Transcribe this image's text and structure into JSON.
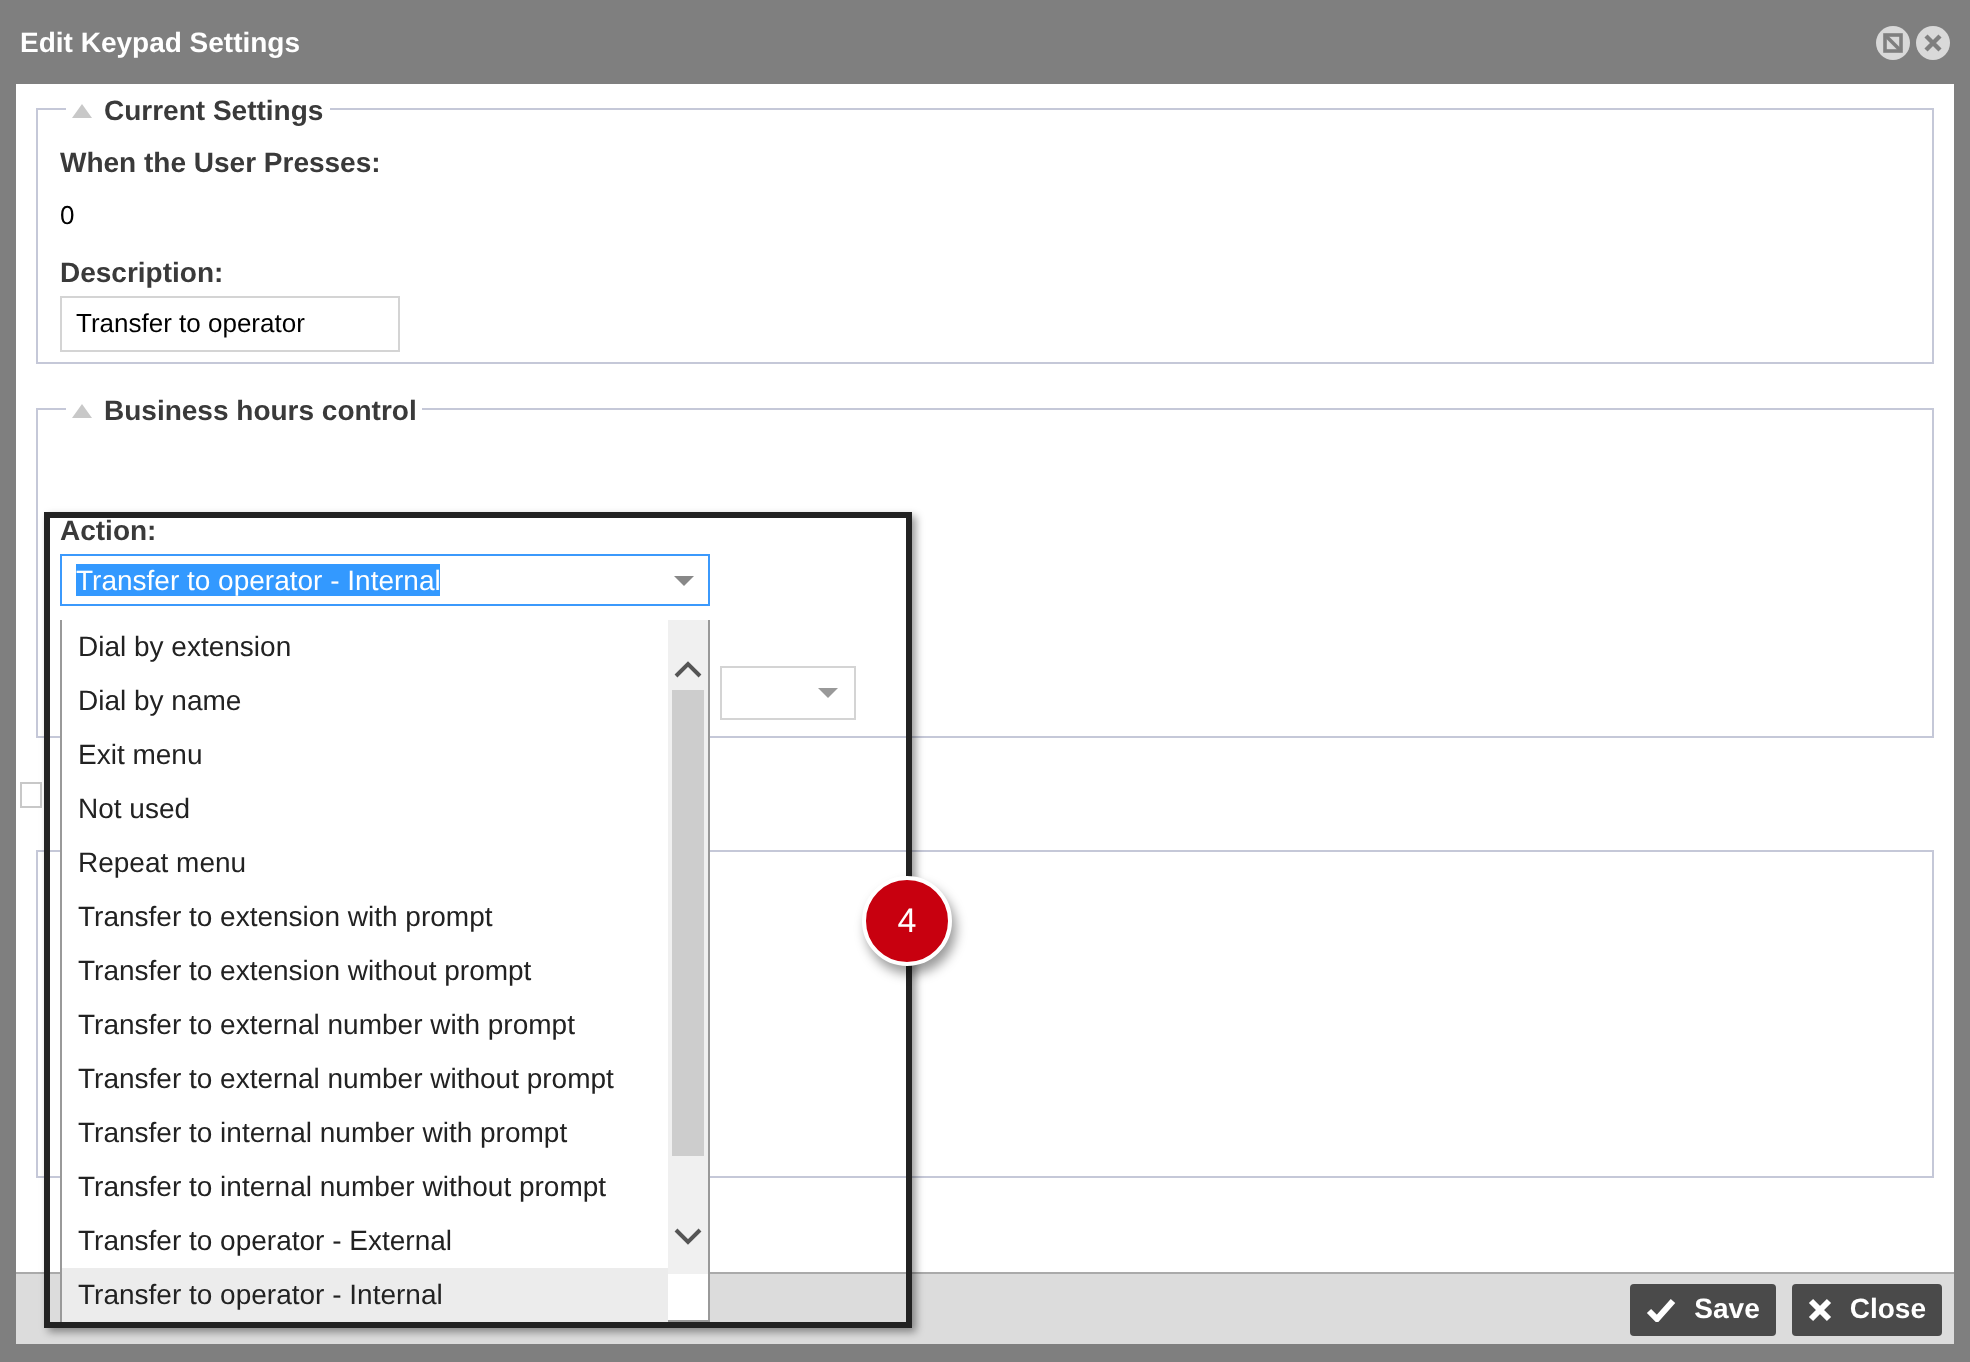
{
  "window": {
    "title": "Edit Keypad Settings"
  },
  "current_settings": {
    "legend": "Current Settings",
    "expanded": true,
    "key_label": "When the User Presses:",
    "key_value": "0",
    "description_label": "Description:",
    "description_value": "Transfer to operator"
  },
  "business_hours": {
    "legend": "Business hours control",
    "expanded": true,
    "action_label": "Action:",
    "action_value": "Transfer to operator - Internal",
    "options": [
      {
        "label": "Dial by extension",
        "selected": false
      },
      {
        "label": "Dial by name",
        "selected": false
      },
      {
        "label": "Exit menu",
        "selected": false
      },
      {
        "label": "Not used",
        "selected": false
      },
      {
        "label": "Repeat menu",
        "selected": false
      },
      {
        "label": "Transfer to extension with prompt",
        "selected": false
      },
      {
        "label": "Transfer to extension without prompt",
        "selected": false
      },
      {
        "label": "Transfer to external number with prompt",
        "selected": false
      },
      {
        "label": "Transfer to external number without prompt",
        "selected": false
      },
      {
        "label": "Transfer to internal number with prompt",
        "selected": false
      },
      {
        "label": "Transfer to internal number without prompt",
        "selected": false
      },
      {
        "label": "Transfer to operator - External",
        "selected": false
      },
      {
        "label": "Transfer to operator - Internal",
        "selected": true
      }
    ]
  },
  "checkbox": {
    "checked": false
  },
  "callout": {
    "number": "4"
  },
  "buttons": [
    {
      "kind": "save",
      "label": "Save"
    },
    {
      "kind": "close",
      "label": "Close"
    }
  ]
}
